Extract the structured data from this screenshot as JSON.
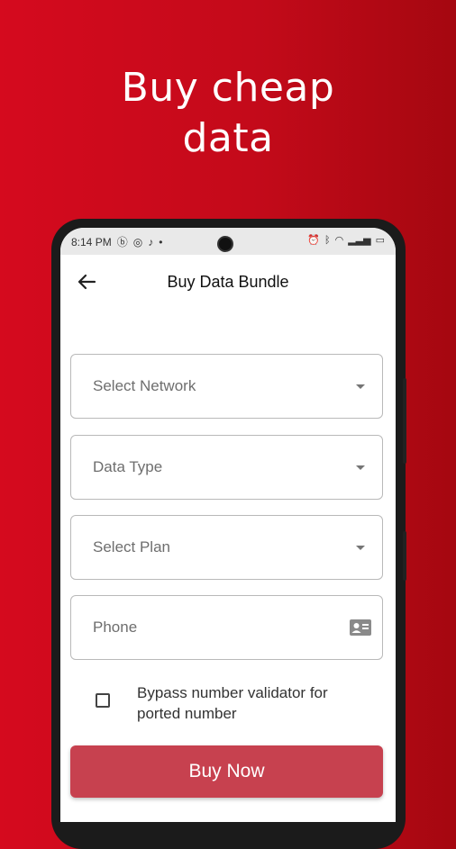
{
  "promo": {
    "headline_line1": "Buy cheap",
    "headline_line2": "data"
  },
  "status_bar": {
    "time": "8:14 PM"
  },
  "app_bar": {
    "title": "Buy Data Bundle"
  },
  "form": {
    "network_placeholder": "Select Network",
    "data_type_placeholder": "Data Type",
    "plan_placeholder": "Select Plan",
    "phone_placeholder": "Phone",
    "bypass_label": "Bypass number validator for ported number",
    "submit_label": "Buy Now"
  },
  "colors": {
    "brand_red": "#d50a1e",
    "button": "#c7414f"
  }
}
